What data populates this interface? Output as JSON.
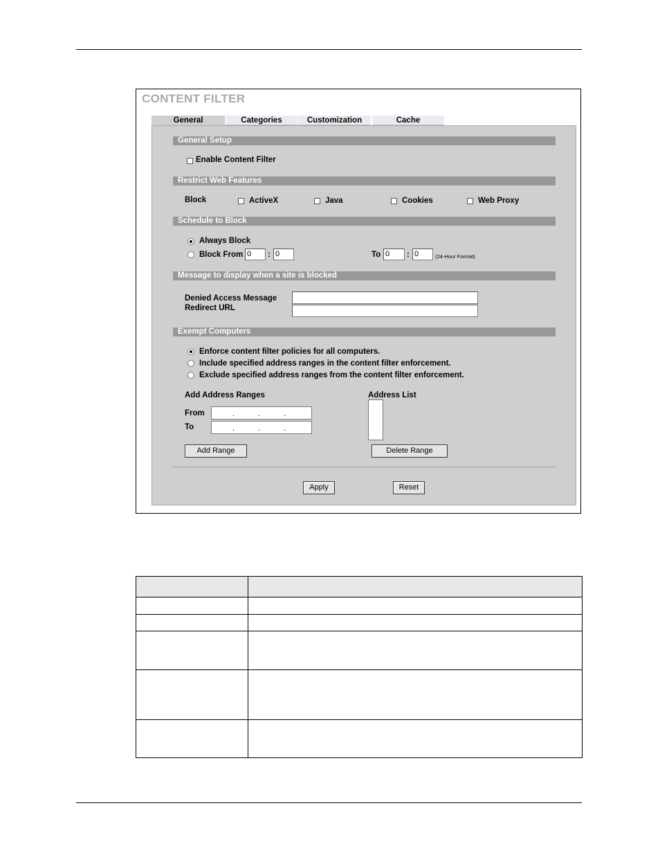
{
  "panel": {
    "title": "CONTENT FILTER",
    "tabs": [
      "General",
      "Categories",
      "Customization",
      "Cache"
    ],
    "sections": {
      "general_setup": "General Setup",
      "restrict_web": "Restrict Web Features",
      "schedule": "Schedule to Block",
      "message": "Message to display when a site is blocked",
      "exempt": "Exempt Computers"
    },
    "enable_label": "Enable Content Filter",
    "block_label": "Block",
    "features": [
      "ActiveX",
      "Java",
      "Cookies",
      "Web Proxy"
    ],
    "always_block": "Always Block",
    "block_from": "Block From",
    "to_label": "To",
    "colon": ":",
    "from_hour": "0",
    "from_min": "0",
    "to_hour": "0",
    "to_min": "0",
    "format_note": "(24-Hour Format)",
    "denied_label": "Denied Access Message",
    "redirect_label": "Redirect URL",
    "exempt_options": [
      "Enforce content filter policies for all computers.",
      "Include specified address ranges in the content filter enforcement.",
      "Exclude specified address ranges from the content filter enforcement."
    ],
    "add_ranges_label": "Add Address Ranges",
    "address_list_label": "Address List",
    "from_label": "From",
    "to_ip_label": "To",
    "ip_dot": ".",
    "add_range_btn": "Add Range",
    "delete_range_btn": "Delete Range",
    "apply_btn": "Apply",
    "reset_btn": "Reset"
  }
}
